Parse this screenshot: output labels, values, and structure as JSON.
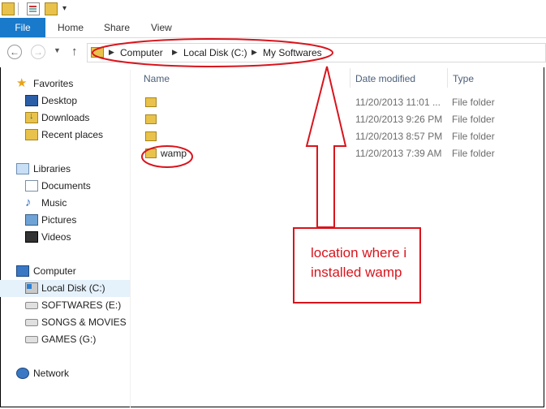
{
  "ribbon": {
    "tabs": [
      "File",
      "Home",
      "Share",
      "View"
    ]
  },
  "address_bar": {
    "crumbs": [
      "Computer",
      "Local Disk (C:)",
      "My Softwares"
    ]
  },
  "nav_pane": {
    "favorites": {
      "label": "Favorites",
      "items": [
        "Desktop",
        "Downloads",
        "Recent places"
      ]
    },
    "libraries": {
      "label": "Libraries",
      "items": [
        "Documents",
        "Music",
        "Pictures",
        "Videos"
      ]
    },
    "computer": {
      "label": "Computer",
      "items": [
        "Local Disk (C:)",
        "SOFTWARES (E:)",
        "SONGS & MOVIES (F",
        "GAMES (G:)"
      ],
      "selected": "Local Disk (C:)"
    },
    "network": {
      "label": "Network"
    }
  },
  "file_list": {
    "columns": [
      "Name",
      "Date modified",
      "Type"
    ],
    "rows": [
      {
        "name": "",
        "date": "11/20/2013 11:01 ...",
        "type": "File folder"
      },
      {
        "name": "",
        "date": "11/20/2013 9:26 PM",
        "type": "File folder"
      },
      {
        "name": "",
        "date": "11/20/2013 8:57 PM",
        "type": "File folder"
      },
      {
        "name": "wamp",
        "date": "11/20/2013 7:39 AM",
        "type": "File folder"
      }
    ]
  },
  "annotation": {
    "text": "location where i installed wamp",
    "color": "#d9141c"
  },
  "colors": {
    "file_tab": "#1979ca",
    "selected_nav": "#e5f1fb",
    "folder": "#e8c24a",
    "header_text": "#4c607a"
  },
  "icons": {
    "quick_access": [
      "folder-icon",
      "properties-icon",
      "new-folder-icon",
      "customize-dropdown-icon"
    ],
    "nav": [
      "back-icon",
      "forward-icon",
      "recent-locations-icon",
      "up-icon"
    ]
  }
}
